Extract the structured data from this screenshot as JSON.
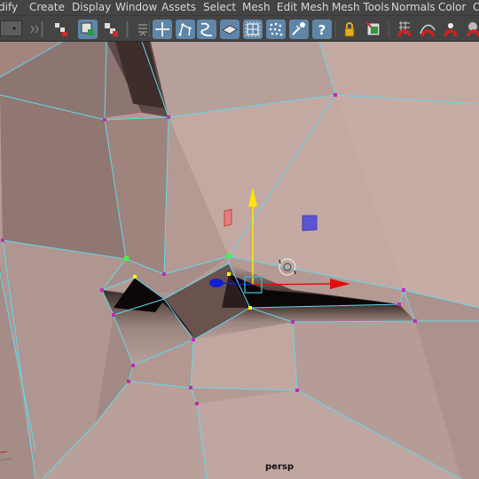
{
  "menubar": {
    "items": [
      "dify",
      "Create",
      "Display",
      "Window",
      "Assets",
      "Select",
      "Mesh",
      "Edit Mesh",
      "Mesh Tools",
      "Normals",
      "Color",
      "C"
    ]
  },
  "shelf": {
    "tool_icons": [
      "mode-dropdown",
      "select-by-hierarchy-icon",
      "select-by-object-icon",
      "select-by-component-icon",
      "move-icon",
      "curve-cv-icon",
      "curve-ep-icon",
      "plane-icon",
      "lattice-icon",
      "particles-icon",
      "paint-effects-icon",
      "help-icon",
      "lock-icon",
      "select-lock-icon",
      "snap-grid-icon",
      "snap-curve-icon",
      "snap-point-icon",
      "snap-view-icon"
    ]
  },
  "viewport": {
    "camera": "persp",
    "colors": {
      "mesh_skin": "#b79c96",
      "edge": "#63d8ec",
      "vertex": "#bd2fb0",
      "selected_vertex": "#ffff00",
      "active_vertex": "#3aff3a",
      "manip_y": "#ffe400",
      "manip_x": "#e01010",
      "manip_z": "#1020d0",
      "manip_center": "#3cb8d8"
    }
  }
}
